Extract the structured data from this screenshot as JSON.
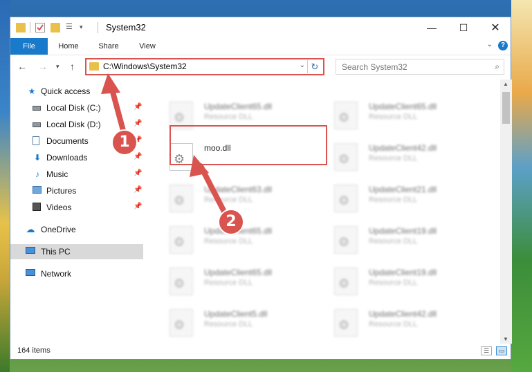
{
  "window": {
    "title": "System32"
  },
  "ribbon": {
    "tabs": [
      "File",
      "Home",
      "Share",
      "View"
    ],
    "help": "?"
  },
  "navigation": {
    "back": "←",
    "forward": "→",
    "up": "↑",
    "address_path": "C:\\Windows\\System32",
    "search_placeholder": "Search System32"
  },
  "sidebar": {
    "items": [
      {
        "label": "Quick access",
        "icon": "star-icon"
      },
      {
        "label": "Local Disk (C:)",
        "icon": "drive-icon",
        "pinned": true
      },
      {
        "label": "Local Disk (D:)",
        "icon": "drive-icon",
        "pinned": true
      },
      {
        "label": "Documents",
        "icon": "documents-icon",
        "pinned": true
      },
      {
        "label": "Downloads",
        "icon": "download-icon",
        "pinned": true
      },
      {
        "label": "Music",
        "icon": "music-icon",
        "pinned": true
      },
      {
        "label": "Pictures",
        "icon": "pictures-icon",
        "pinned": true
      },
      {
        "label": "Videos",
        "icon": "videos-icon",
        "pinned": true
      },
      {
        "label": "OneDrive",
        "icon": "cloud-icon"
      },
      {
        "label": "This PC",
        "icon": "computer-icon",
        "selected": true
      },
      {
        "label": "Network",
        "icon": "network-icon"
      }
    ]
  },
  "files": [
    {
      "name": "UpdateClient65.dll",
      "type": "Resource DLL"
    },
    {
      "name": "UpdateClient65.dll",
      "type": "Resource DLL"
    },
    {
      "name": "moo.dll",
      "type": ""
    },
    {
      "name": "UpdateClient42.dll",
      "type": "Resource DLL"
    },
    {
      "name": "UpdateClient63.dll",
      "type": "Resource DLL"
    },
    {
      "name": "UpdateClient21.dll",
      "type": "Resource DLL"
    },
    {
      "name": "UpdateClient65.dll",
      "type": "Resource DLL"
    },
    {
      "name": "UpdateClient19.dll",
      "type": "Resource DLL"
    },
    {
      "name": "UpdateClient65.dll",
      "type": "Resource DLL"
    },
    {
      "name": "UpdateClient19.dll",
      "type": "Resource DLL"
    },
    {
      "name": "UpdateClient5.dll",
      "type": "Resource DLL"
    },
    {
      "name": "UpdateClient42.dll",
      "type": "Resource DLL"
    }
  ],
  "status": {
    "item_count": "164 items"
  },
  "annotations": {
    "step1": "1",
    "step2": "2"
  },
  "colors": {
    "accent": "#1979ca",
    "highlight": "#d9534f"
  }
}
